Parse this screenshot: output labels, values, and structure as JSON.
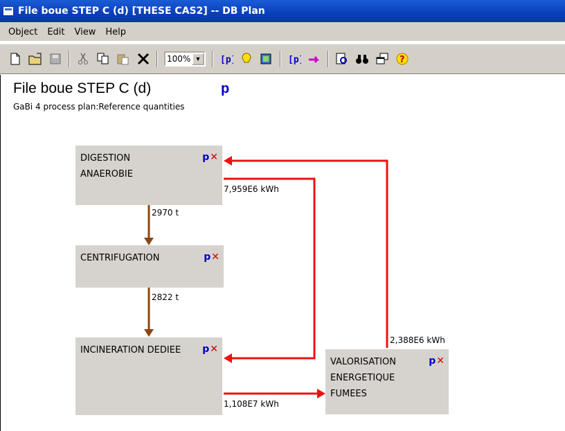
{
  "window": {
    "title": "File boue STEP C (d) [THESE CAS2] -- DB Plan"
  },
  "menu": [
    "Object",
    "Edit",
    "View",
    "Help"
  ],
  "toolbar": {
    "zoom": "100%"
  },
  "plan": {
    "title": "File boue STEP C (d)",
    "p_marker": "p",
    "subtitle": "GaBi 4 process plan:Reference quantities"
  },
  "processes": {
    "digestion": {
      "name": "DIGESTION\nANAEROBIE",
      "p": "p",
      "x": "✕"
    },
    "centrifugation": {
      "name": "CENTRIFUGATION",
      "p": "p",
      "x": "✕"
    },
    "incineration": {
      "name": "INCINERATION DEDIEE",
      "p": "p",
      "x": "✕"
    },
    "valorisation": {
      "name": "VALORISATION\nENERGETIQUE\nFUMEES",
      "p": "p",
      "x": "✕"
    }
  },
  "flows": {
    "digestion_to_centrifugation": "2970 t",
    "centrifugation_to_incineration": "2822 t",
    "incineration_to_valorisation": "1,108E7 kWh",
    "valorisation_to_digestion": "2,388E6 kWh",
    "valorisation_to_incineration": "7,959E6 kWh"
  },
  "colors": {
    "mass_flow": "#8b4513",
    "energy_flow": "#ee1111",
    "process_box": "#d6d3ce",
    "title_bar": "#0a3fb8"
  }
}
